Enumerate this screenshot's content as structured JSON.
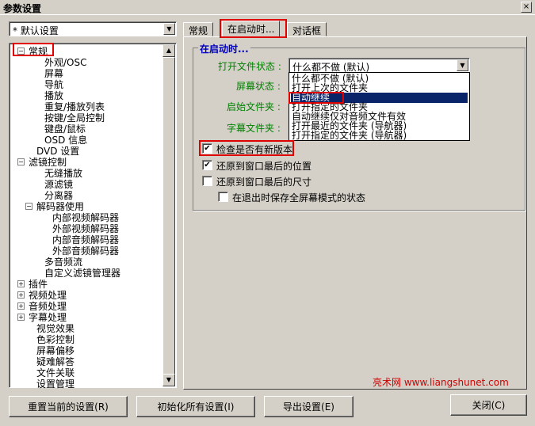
{
  "window": {
    "title": "参数设置",
    "close_glyph": "×"
  },
  "preset_combo": {
    "value": "* 默认设置"
  },
  "tree": {
    "items": [
      {
        "label": "常规",
        "expander": "−"
      },
      {
        "label": "外观/OSC"
      },
      {
        "label": "屏幕"
      },
      {
        "label": "导航"
      },
      {
        "label": "播放"
      },
      {
        "label": "重复/播放列表"
      },
      {
        "label": "按键/全局控制"
      },
      {
        "label": "键盘/鼠标"
      },
      {
        "label": "OSD 信息"
      },
      {
        "label": "DVD 设置"
      },
      {
        "label": "滤镜控制",
        "expander": "−"
      },
      {
        "label": "无缝播放"
      },
      {
        "label": "源滤镜"
      },
      {
        "label": "分离器"
      },
      {
        "label": "解码器使用",
        "expander": "−"
      },
      {
        "label": "内部视频解码器"
      },
      {
        "label": "外部视频解码器"
      },
      {
        "label": "内部音频解码器"
      },
      {
        "label": "外部音频解码器"
      },
      {
        "label": "多音频流"
      },
      {
        "label": "自定义滤镜管理器"
      },
      {
        "label": "插件",
        "expander": "+"
      },
      {
        "label": "视频处理",
        "expander": "+"
      },
      {
        "label": "音频处理",
        "expander": "+"
      },
      {
        "label": "字幕处理",
        "expander": "+"
      },
      {
        "label": "视觉效果"
      },
      {
        "label": "色彩控制"
      },
      {
        "label": "屏幕偏移"
      },
      {
        "label": "疑难解答"
      },
      {
        "label": "文件关联"
      },
      {
        "label": "设置管理"
      }
    ]
  },
  "tabs": [
    {
      "label": "常规"
    },
    {
      "label": "在启动时..."
    },
    {
      "label": "对话框"
    }
  ],
  "startup": {
    "group_title": "在启动时...",
    "labels": {
      "open_file_state": "打开文件状态 :",
      "screen_state": "屏幕状态 :",
      "start_folder": "启始文件夹 :",
      "subtitle_folder": "字幕文件夹 :"
    },
    "open_file_combo_value": "什么都不做 (默认)",
    "dropdown_options": [
      "什么都不做 (默认)",
      "打开上次的文件夹",
      "自动继续",
      "打开指定的文件夹",
      "自动继续仅对音频文件有效",
      "打开最近的文件夹 (导航器)",
      "打开指定的文件夹 (导航器)"
    ],
    "selected_option": "自动继续",
    "checkboxes": [
      {
        "label": "检查是否有新版本",
        "checked": true
      },
      {
        "label": "还原到窗口最后的位置",
        "checked": true
      },
      {
        "label": "还原到窗口最后的尺寸",
        "checked": false
      },
      {
        "label": "在退出时保存全屏幕模式的状态",
        "checked": false
      }
    ],
    "check_glyph": "✔"
  },
  "buttons": {
    "reset": "重置当前的设置(R)",
    "init_all": "初始化所有设置(I)",
    "export": "导出设置(E)",
    "close": "关闭(C)"
  },
  "watermark": "亮术网 www.liangshunet.com",
  "colors": {
    "highlight": "#e00000",
    "selection": "#0a246a",
    "label_green": "#008000",
    "group_title_blue": "#0000c0"
  }
}
